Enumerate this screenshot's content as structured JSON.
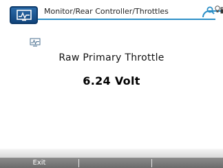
{
  "header": {
    "breadcrumb": "Monitor/Rear Controller/Throttles",
    "icons": [
      "monitor-home-icon",
      "search-icon",
      "lightbulb-icon",
      "device-icon"
    ]
  },
  "main": {
    "icon": "monitor-icon",
    "title": "Raw Primary Throttle",
    "value": "6.24 Volt"
  },
  "softkeys": [
    {
      "label": "Exit"
    },
    {
      "label": ""
    },
    {
      "label": ""
    }
  ],
  "colors": {
    "accent": "#2b8fc7",
    "home_button": "#1a5590",
    "softkey_bar": "#7a7a7a"
  }
}
